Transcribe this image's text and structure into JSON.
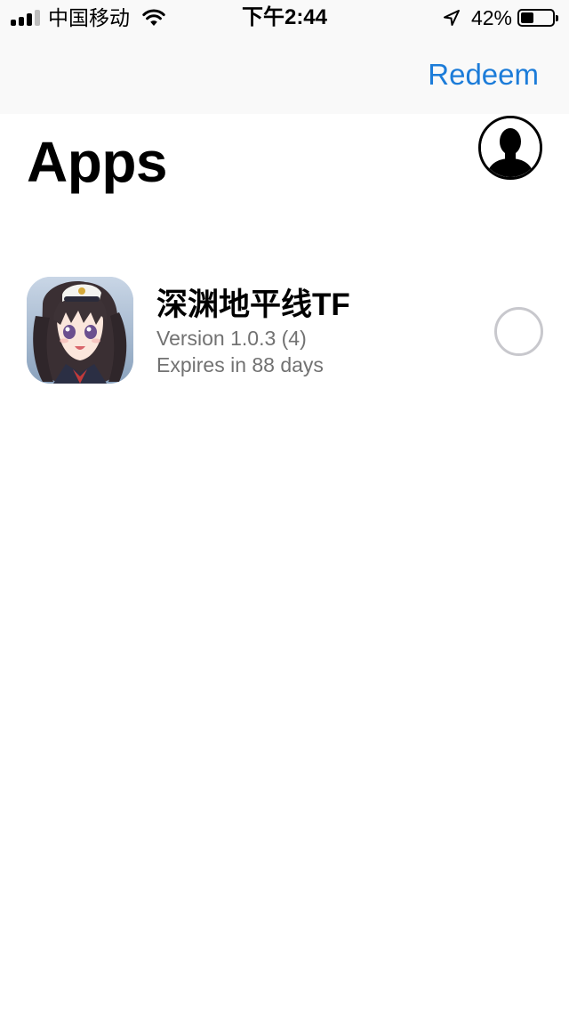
{
  "status_bar": {
    "carrier": "中国移动",
    "time": "下午2:44",
    "battery_percent": "42%",
    "battery_level": 0.42,
    "signal_bars_filled": 3,
    "signal_bars_total": 4,
    "icons": [
      "signal-icon",
      "wifi-icon",
      "location-arrow-icon",
      "battery-icon"
    ]
  },
  "nav": {
    "redeem_label": "Redeem",
    "accent_color": "#1c7cd9"
  },
  "header": {
    "title": "Apps",
    "account_icon": "person-silhouette-icon"
  },
  "apps": [
    {
      "name": "深渊地平线TF",
      "version": "Version 1.0.3 (4)",
      "expires": "Expires in 88 days",
      "icon": "app-artwork-icon",
      "selected": false
    }
  ]
}
